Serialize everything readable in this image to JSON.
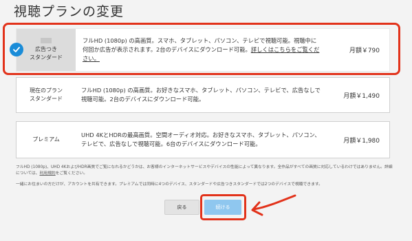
{
  "header": {
    "title": "視聴プランの変更"
  },
  "plans": [
    {
      "name_line1": "広告つき",
      "name_line2": "スタンダード",
      "description": "フルHD (1080p) の高画質。スマホ、タブレット、パソコン、テレビで視聴可能。視聴中に何回か広告が表示されます。2台のデバイスにダウンロード可能。",
      "link": "詳しくはこちらをご覧ください。",
      "price": "月額￥790",
      "selected": true
    },
    {
      "name_line1": "現在のプラン",
      "name_line2": "スタンダード",
      "description": "フルHD (1080p) の高画質。お好きなスマホ、タブレット、パソコン、テレビで、広告なしで視聴可能。2台のデバイスにダウンロード可能。",
      "price": "月額￥1,490"
    },
    {
      "name_line1": "プレミアム",
      "description": "UHD 4KとHDRの最高画質。空間オーディオ対応。お好きなスマホ、タブレット、パソコン、テレビで、広告なしで視聴可能。6台のデバイスにダウンロード可能。",
      "price": "月額￥1,980"
    }
  ],
  "footnotes": {
    "note1_a": "フルHD (1080p)、UHD 4KおよびHDR画質でご覧になれるかどうかは、お客様のインターネットサービスやデバイスの性能によって異なります。全作品がすべての画質に対応しているわけではありません。詳細については、",
    "note1_link": "利用規約",
    "note1_b": "をご覧ください。",
    "note2": "一緒にお住まいの方だけが、アカウントを共有できます。プレミアムでは同時に4つのデバイス、スタンダードや広告つきスタンダードでは2つのデバイスで視聴できます。"
  },
  "buttons": {
    "back": "戻る",
    "continue": "続ける"
  },
  "colors": {
    "accent_blue": "#1a8cd8",
    "highlight_red": "#e2321a",
    "continue_button": "#8fc7ef"
  },
  "icons": {
    "selected": "check-icon",
    "annotation": "red-arrow-icon"
  }
}
